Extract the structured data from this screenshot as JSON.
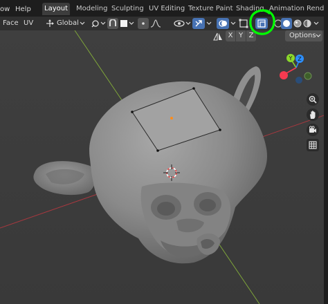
{
  "menubar": {
    "items": [
      "ow",
      "Help"
    ],
    "workspaces": [
      "Layout",
      "Modeling",
      "Sculpting",
      "UV Editing",
      "Texture Paint",
      "Shading",
      "Animation",
      "Render"
    ],
    "active_workspace": "Layout"
  },
  "header": {
    "left_items": [
      "Face",
      "UV"
    ],
    "transform_orientation": "Global",
    "options_label": "Options"
  },
  "mirror_axes": [
    "X",
    "Y",
    "Z"
  ],
  "gizmo": {
    "x_label": "X",
    "y_label": "Y",
    "z_label": "Z",
    "colors": {
      "x": "#f53a50",
      "y": "#8bd82b",
      "z": "#2c8fff"
    }
  },
  "icons": [
    "snap-icon",
    "proportional-edit-icon",
    "overlay-icon",
    "xray-icon",
    "zoom-icon",
    "hand-pan-icon",
    "camera-icon",
    "grid-icon",
    "3d-cursor-icon"
  ],
  "annotation_color": "#00ff00"
}
